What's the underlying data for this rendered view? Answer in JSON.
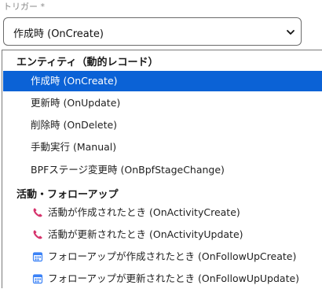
{
  "field": {
    "label": "トリガー *",
    "selected_value": "作成時 (OnCreate)"
  },
  "dropdown": {
    "groups": [
      {
        "header": "エンティティ（動的レコード）",
        "options": [
          {
            "label": "作成時 (OnCreate)",
            "selected": true
          },
          {
            "label": "更新時 (OnUpdate)"
          },
          {
            "label": "削除時 (OnDelete)"
          },
          {
            "label": "手動実行 (Manual)"
          },
          {
            "label": "BPFステージ変更時 (OnBpfStageChange)"
          }
        ]
      },
      {
        "header": "活動・フォローアップ",
        "options": [
          {
            "label": "活動が作成されたとき (OnActivityCreate)",
            "icon": "phone-icon"
          },
          {
            "label": "活動が更新されたとき (OnActivityUpdate)",
            "icon": "phone-icon"
          },
          {
            "label": "フォローアップが作成されたとき (OnFollowUpCreate)",
            "icon": "calendar-icon"
          },
          {
            "label": "フォローアップが更新されたとき (OnFollowUpUpdate)",
            "icon": "calendar-icon"
          }
        ]
      }
    ]
  },
  "colors": {
    "selected_bg": "#0b62d6",
    "phone_icon": "#d6336c",
    "calendar_icon": "#3b82f6"
  }
}
